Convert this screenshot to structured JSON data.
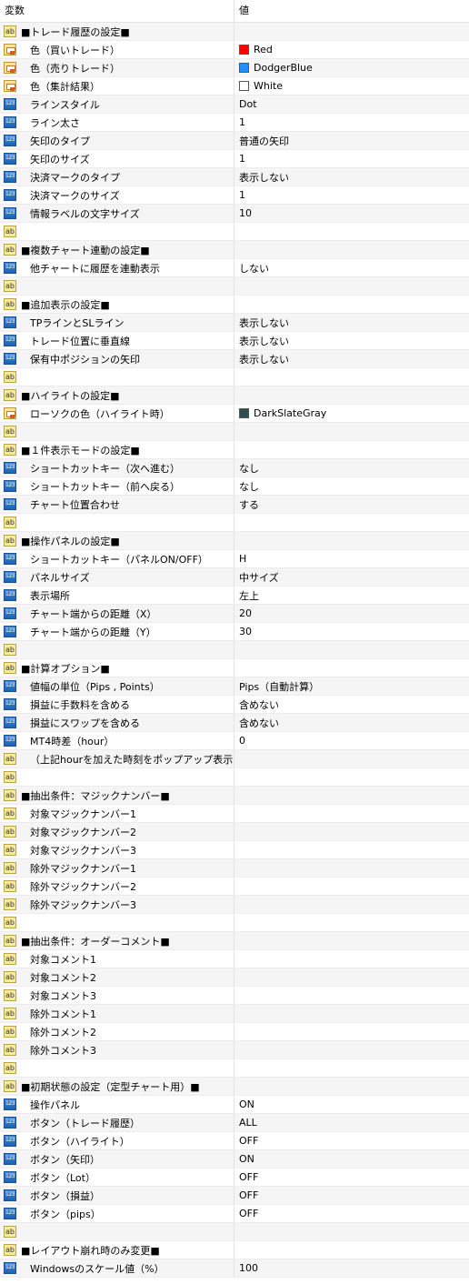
{
  "header": {
    "name": "変数",
    "value": "値"
  },
  "rows": [
    {
      "icon": "str",
      "name": "■トレード履歴の設定■",
      "value": "",
      "section": true
    },
    {
      "icon": "col",
      "name": "色（買いトレード）",
      "value": "Red",
      "swatch": "#ff0000"
    },
    {
      "icon": "col",
      "name": "色（売りトレード）",
      "value": "DodgerBlue",
      "swatch": "#1e90ff"
    },
    {
      "icon": "col",
      "name": "色（集計結果）",
      "value": "White",
      "swatch": "#ffffff"
    },
    {
      "icon": "int",
      "name": "ラインスタイル",
      "value": "Dot"
    },
    {
      "icon": "int",
      "name": "ライン太さ",
      "value": "1"
    },
    {
      "icon": "int",
      "name": "矢印のタイプ",
      "value": "普通の矢印"
    },
    {
      "icon": "int",
      "name": "矢印のサイズ",
      "value": "1"
    },
    {
      "icon": "int",
      "name": "決済マークのタイプ",
      "value": "表示しない"
    },
    {
      "icon": "int",
      "name": "決済マークのサイズ",
      "value": "1"
    },
    {
      "icon": "int",
      "name": "情報ラベルの文字サイズ",
      "value": "10"
    },
    {
      "icon": "str",
      "name": "",
      "value": ""
    },
    {
      "icon": "str",
      "name": "■複数チャート連動の設定■",
      "value": "",
      "section": true
    },
    {
      "icon": "int",
      "name": "他チャートに履歴を連動表示",
      "value": "しない"
    },
    {
      "icon": "str",
      "name": "",
      "value": ""
    },
    {
      "icon": "str",
      "name": "■追加表示の設定■",
      "value": "",
      "section": true
    },
    {
      "icon": "int",
      "name": "TPラインとSLライン",
      "value": "表示しない"
    },
    {
      "icon": "int",
      "name": "トレード位置に垂直線",
      "value": "表示しない"
    },
    {
      "icon": "int",
      "name": "保有中ポジションの矢印",
      "value": "表示しない"
    },
    {
      "icon": "str",
      "name": "",
      "value": ""
    },
    {
      "icon": "str",
      "name": "■ハイライトの設定■",
      "value": "",
      "section": true
    },
    {
      "icon": "col",
      "name": "ローソクの色（ハイライト時）",
      "value": "DarkSlateGray",
      "swatch": "#2f4f4f"
    },
    {
      "icon": "str",
      "name": "",
      "value": ""
    },
    {
      "icon": "str",
      "name": "■１件表示モードの設定■",
      "value": "",
      "section": true
    },
    {
      "icon": "int",
      "name": "ショートカットキー（次へ進む）",
      "value": "なし"
    },
    {
      "icon": "int",
      "name": "ショートカットキー（前へ戻る）",
      "value": "なし"
    },
    {
      "icon": "int",
      "name": "チャート位置合わせ",
      "value": "する"
    },
    {
      "icon": "str",
      "name": "",
      "value": ""
    },
    {
      "icon": "str",
      "name": "■操作パネルの設定■",
      "value": "",
      "section": true
    },
    {
      "icon": "int",
      "name": "ショートカットキー（パネルON/OFF）",
      "value": "H"
    },
    {
      "icon": "int",
      "name": "パネルサイズ",
      "value": "中サイズ"
    },
    {
      "icon": "int",
      "name": "表示場所",
      "value": "左上"
    },
    {
      "icon": "int",
      "name": "チャート端からの距離（X）",
      "value": "20"
    },
    {
      "icon": "int",
      "name": "チャート端からの距離（Y）",
      "value": "30"
    },
    {
      "icon": "str",
      "name": "",
      "value": ""
    },
    {
      "icon": "str",
      "name": "■計算オプション■",
      "value": "",
      "section": true
    },
    {
      "icon": "int",
      "name": "値幅の単位（Pips , Points）",
      "value": "Pips（自動計算）"
    },
    {
      "icon": "int",
      "name": "損益に手数料を含める",
      "value": "含めない"
    },
    {
      "icon": "int",
      "name": "損益にスワップを含める",
      "value": "含めない"
    },
    {
      "icon": "int",
      "name": "MT4時差（hour）",
      "value": "0"
    },
    {
      "icon": "str",
      "name": "（上記hourを加えた時刻をポップアップ表示...",
      "value": ""
    },
    {
      "icon": "str",
      "name": "",
      "value": ""
    },
    {
      "icon": "str",
      "name": "■抽出条件：マジックナンバー■",
      "value": "",
      "section": true
    },
    {
      "icon": "str",
      "name": "対象マジックナンバー1",
      "value": ""
    },
    {
      "icon": "str",
      "name": "対象マジックナンバー2",
      "value": ""
    },
    {
      "icon": "str",
      "name": "対象マジックナンバー3",
      "value": ""
    },
    {
      "icon": "str",
      "name": "除外マジックナンバー1",
      "value": ""
    },
    {
      "icon": "str",
      "name": "除外マジックナンバー2",
      "value": ""
    },
    {
      "icon": "str",
      "name": "除外マジックナンバー3",
      "value": ""
    },
    {
      "icon": "str",
      "name": "",
      "value": ""
    },
    {
      "icon": "str",
      "name": "■抽出条件：オーダーコメント■",
      "value": "",
      "section": true
    },
    {
      "icon": "str",
      "name": "対象コメント1",
      "value": ""
    },
    {
      "icon": "str",
      "name": "対象コメント2",
      "value": ""
    },
    {
      "icon": "str",
      "name": "対象コメント3",
      "value": ""
    },
    {
      "icon": "str",
      "name": "除外コメント1",
      "value": ""
    },
    {
      "icon": "str",
      "name": "除外コメント2",
      "value": ""
    },
    {
      "icon": "str",
      "name": "除外コメント3",
      "value": ""
    },
    {
      "icon": "str",
      "name": "",
      "value": ""
    },
    {
      "icon": "str",
      "name": "■初期状態の設定（定型チャート用）■",
      "value": "",
      "section": true
    },
    {
      "icon": "int",
      "name": "操作パネル",
      "value": "ON"
    },
    {
      "icon": "int",
      "name": "ボタン（トレード履歴）",
      "value": "ALL"
    },
    {
      "icon": "int",
      "name": "ボタン（ハイライト）",
      "value": "OFF"
    },
    {
      "icon": "int",
      "name": "ボタン（矢印）",
      "value": "ON"
    },
    {
      "icon": "int",
      "name": "ボタン（Lot）",
      "value": "OFF"
    },
    {
      "icon": "int",
      "name": "ボタン（損益）",
      "value": "OFF"
    },
    {
      "icon": "int",
      "name": "ボタン（pips）",
      "value": "OFF"
    },
    {
      "icon": "str",
      "name": "",
      "value": ""
    },
    {
      "icon": "str",
      "name": "■レイアウト崩れ時のみ変更■",
      "value": "",
      "section": true
    },
    {
      "icon": "int",
      "name": "Windowsのスケール値（%）",
      "value": "100"
    }
  ]
}
